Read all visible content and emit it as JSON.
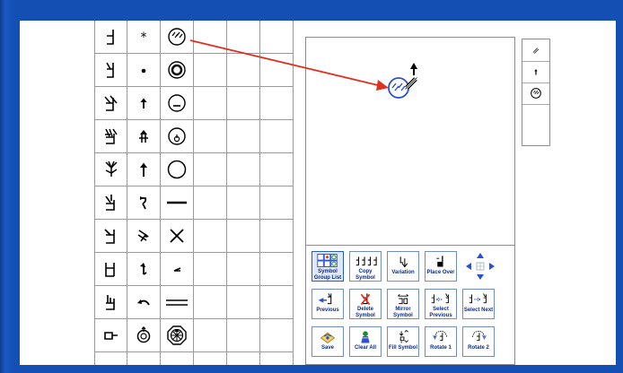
{
  "palette": {
    "rows": [
      {
        "hand": "hand-shape-1",
        "move": "asterisk-icon",
        "face": "face-circle-eyes-up-icon"
      },
      {
        "hand": "hand-shape-2",
        "move": "dot-icon",
        "face": "face-circle-ring-icon"
      },
      {
        "hand": "hand-shape-3",
        "move": "up-arrow-small-icon",
        "face": "face-circle-mouth-icon"
      },
      {
        "hand": "hand-shape-4",
        "move": "double-up-arrow-icon",
        "face": "face-circle-nose-icon"
      },
      {
        "hand": "hand-shape-5",
        "move": "up-arrow-icon",
        "face": "face-circle-empty-icon"
      },
      {
        "hand": "hand-shape-6",
        "move": "curved-arrow-icon",
        "face": "horizontal-bar-icon"
      },
      {
        "hand": "hand-shape-7",
        "move": "diagonal-arrow-icon",
        "face": "cross-x-icon"
      },
      {
        "hand": "hand-shape-8",
        "move": "hook-arrow-icon",
        "face": "angle-mark-icon"
      },
      {
        "hand": "hand-shape-9",
        "move": "curl-arrow-icon",
        "face": "double-line-icon"
      },
      {
        "hand": "hand-shape-10",
        "move": "rotate-circle-icon",
        "face": "octagon-star-icon"
      }
    ]
  },
  "sequence": {
    "items": [
      "contact-diagonal-icon",
      "up-arrow-small-icon",
      "face-circle-eyes-up-icon"
    ]
  },
  "toolbar": {
    "buttons": [
      {
        "name": "symbol-group-list-button",
        "label": "Symbol Group List",
        "icon": "symbol-group-list-icon"
      },
      {
        "name": "copy-symbol-button",
        "label": "Copy Symbol",
        "icon": "copy-symbol-icon"
      },
      {
        "name": "variation-button",
        "label": "Variation",
        "icon": "variation-icon"
      },
      {
        "name": "place-over-button",
        "label": "Place Over",
        "icon": "place-over-icon"
      },
      {
        "name": "previous-button",
        "label": "Previous",
        "icon": "previous-icon"
      },
      {
        "name": "delete-symbol-button",
        "label": "Delete Symbol",
        "icon": "delete-symbol-icon"
      },
      {
        "name": "mirror-symbol-button",
        "label": "Mirror Symbol",
        "icon": "mirror-symbol-icon"
      },
      {
        "name": "select-previous-button",
        "label": "Select Previous",
        "icon": "select-previous-icon"
      },
      {
        "name": "select-next-button",
        "label": "Select Next",
        "icon": "select-next-icon"
      },
      {
        "name": "save-button",
        "label": "Save",
        "icon": "save-icon"
      },
      {
        "name": "clear-all-button",
        "label": "Clear All",
        "icon": "clear-all-icon"
      },
      {
        "name": "fill-symbol-button",
        "label": "Fill Symbol",
        "icon": "fill-symbol-icon"
      },
      {
        "name": "rotate-1-button",
        "label": "Rotate 1",
        "icon": "rotate-1-icon"
      },
      {
        "name": "rotate-2-button",
        "label": "Rotate 2",
        "icon": "rotate-2-icon"
      }
    ]
  },
  "colors": {
    "frame_blue": "#1450b4",
    "annotation_red": "#e03020",
    "selection_blue": "#2a4fd8",
    "label_blue": "#0b2c8a"
  }
}
